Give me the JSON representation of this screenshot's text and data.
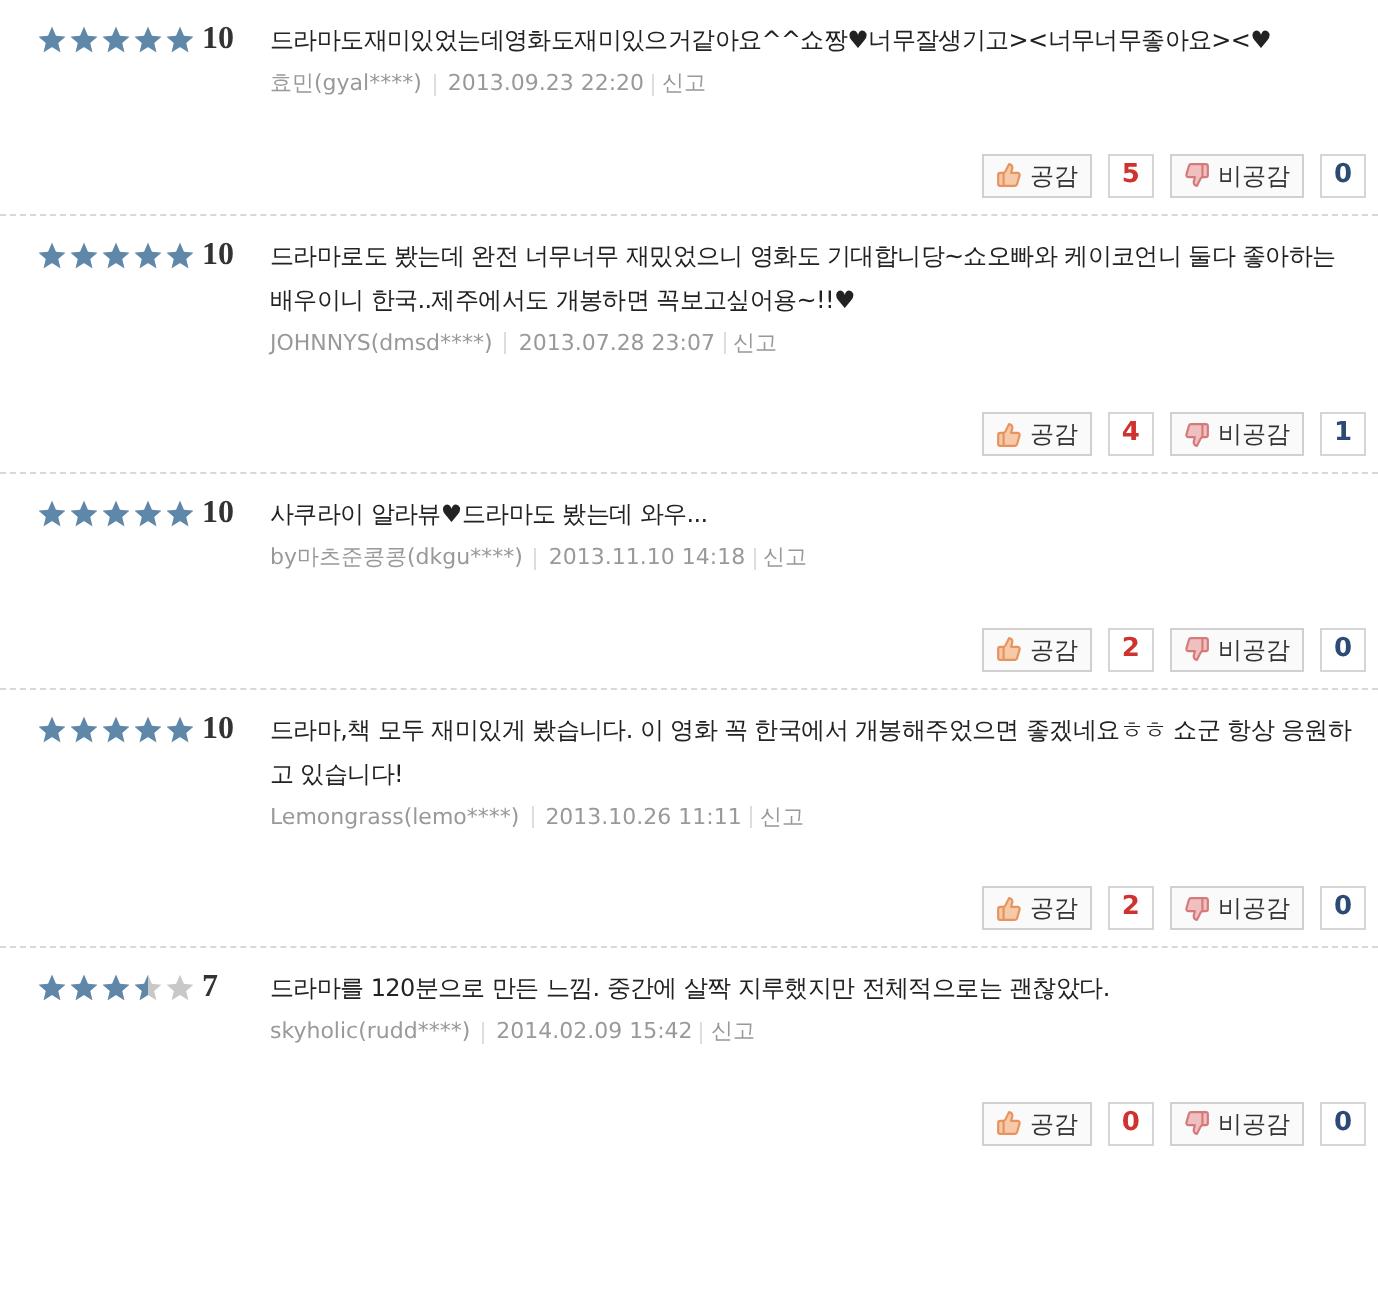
{
  "reviews": [
    {
      "stars": 5,
      "score": "10",
      "text": "드라마도재미있었는데영화도재미있으거같아요^^쇼짱♥너무잘생기고><너무너무좋아요><♥",
      "author": "효민(gyal****)",
      "date": "2013.09.23 22:20",
      "report": "신고",
      "like_label": "공감",
      "likes": "5",
      "dislike_label": "비공감",
      "dislikes": "0"
    },
    {
      "stars": 5,
      "score": "10",
      "text": "드라마로도 봤는데 완전 너무너무 재밌었으니 영화도 기대합니당~쇼오빠와 케이코언니 둘다 좋아하는 배우이니 한국..제주에서도 개봉하면 꼭보고싶어용~!!♥",
      "author": "JOHNNYS(dmsd****)",
      "date": "2013.07.28 23:07",
      "report": "신고",
      "like_label": "공감",
      "likes": "4",
      "dislike_label": "비공감",
      "dislikes": "1"
    },
    {
      "stars": 5,
      "score": "10",
      "text": "사쿠라이 알라뷰♥드라마도 봤는데 와우...",
      "author": "by마츠준콩콩(dkgu****)",
      "date": "2013.11.10 14:18",
      "report": "신고",
      "like_label": "공감",
      "likes": "2",
      "dislike_label": "비공감",
      "dislikes": "0"
    },
    {
      "stars": 5,
      "score": "10",
      "text": "드라마,책 모두 재미있게 봤습니다. 이 영화 꼭 한국에서 개봉해주었으면 좋겠네요ㅎㅎ 쇼군 항상 응원하고 있습니다!",
      "author": "Lemongrass(lemo****)",
      "date": "2013.10.26 11:11",
      "report": "신고",
      "like_label": "공감",
      "likes": "2",
      "dislike_label": "비공감",
      "dislikes": "0"
    },
    {
      "stars": 3.5,
      "score": "7",
      "text": "드라마를 120분으로 만든 느낌. 중간에 살짝 지루했지만 전체적으로는 괜찮았다.",
      "author": "skyholic(rudd****)",
      "date": "2014.02.09 15:42",
      "report": "신고",
      "like_label": "공감",
      "likes": "0",
      "dislike_label": "비공감",
      "dislikes": "0"
    }
  ]
}
